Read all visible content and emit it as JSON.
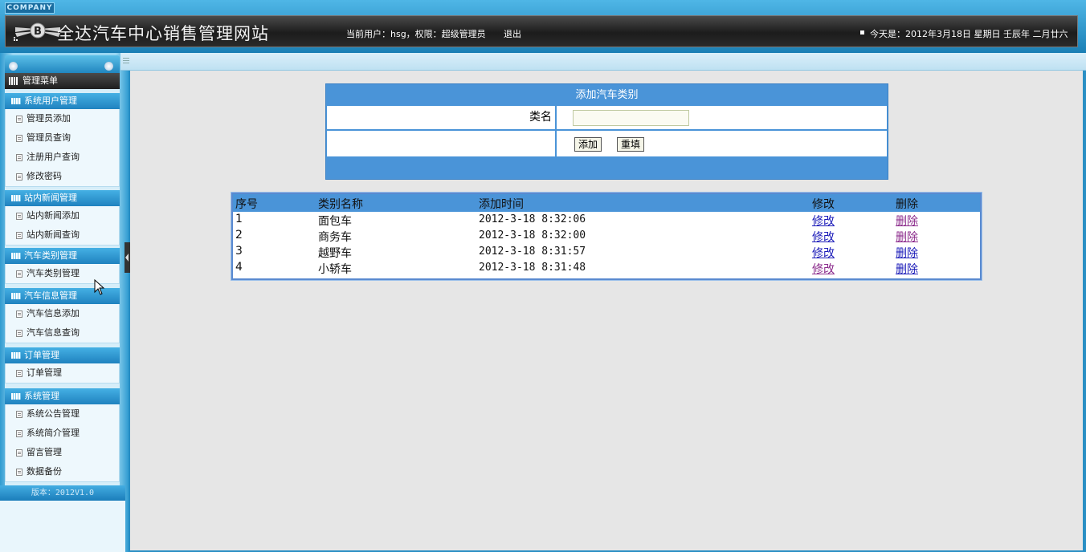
{
  "header": {
    "company_tab": "COMPANY",
    "site_title": "全达汽车中心销售管理网站",
    "user_info": "当前用户：hsg，权限：超级管理员",
    "logout": "退出",
    "date": "今天是：2012年3月18日  星期日  壬辰年  二月廿六"
  },
  "sidebar": {
    "menu_title": "管理菜单",
    "groups": [
      {
        "title": "系统用户管理",
        "items": [
          "管理员添加",
          "管理员查询",
          "注册用户查询",
          "修改密码"
        ]
      },
      {
        "title": "站内新闻管理",
        "items": [
          "站内新闻添加",
          "站内新闻查询"
        ]
      },
      {
        "title": "汽车类别管理",
        "items": [
          "汽车类别管理"
        ]
      },
      {
        "title": "汽车信息管理",
        "items": [
          "汽车信息添加",
          "汽车信息查询"
        ]
      },
      {
        "title": "订单管理",
        "items": [
          "订单管理"
        ]
      },
      {
        "title": "系统管理",
        "items": [
          "系统公告管理",
          "系统简介管理",
          "留言管理",
          "数据备份"
        ]
      }
    ],
    "version": "版本：2012V1.0"
  },
  "form": {
    "title": "添加汽车类别",
    "name_label": "类名",
    "name_value": "",
    "add_button": "添加",
    "reset_button": "重填"
  },
  "table": {
    "headers": [
      "序号",
      "类别名称",
      "添加时间",
      "修改",
      "删除"
    ],
    "rows": [
      {
        "no": "1",
        "name": "面包车",
        "time": "2012-3-18 8:32:06",
        "edit": "修改",
        "delete": "删除"
      },
      {
        "no": "2",
        "name": "商务车",
        "time": "2012-3-18 8:32:00",
        "edit": "修改",
        "delete": "删除"
      },
      {
        "no": "3",
        "name": "越野车",
        "time": "2012-3-18 8:31:57",
        "edit": "修改",
        "delete": "删除"
      },
      {
        "no": "4",
        "name": "小轿车",
        "time": "2012-3-18 8:31:48",
        "edit": "修改",
        "delete": "删除"
      }
    ]
  },
  "colors": {
    "accent": "#4a94d8",
    "link": "#1a1ab8",
    "visited_link": "#8b2a8b"
  }
}
